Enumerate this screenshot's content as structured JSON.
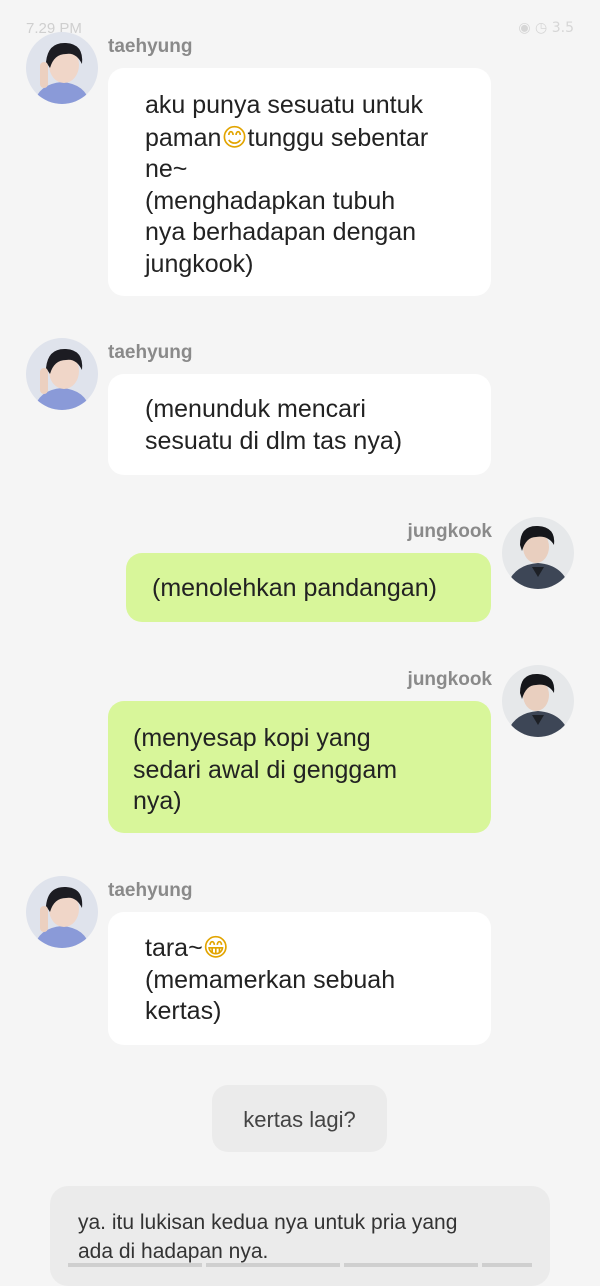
{
  "status_bar": {
    "time": "7.29 PM",
    "icons": "◉ ◷ 3.5"
  },
  "messages": [
    {
      "sender": "taehyung",
      "text_before": "aku punya sesuatu untuk\npaman",
      "emoji": "😊",
      "text_after": "tunggu sebentar\nne~\n(menghadapkan tubuh\nnya berhadapan dengan\njungkook)"
    },
    {
      "sender": "taehyung",
      "text": "(menunduk mencari\nsesuatu di dlm tas nya)"
    },
    {
      "sender": "jungkook",
      "text": "(menolehkan pandangan)"
    },
    {
      "sender": "jungkook",
      "text": "(menyesap kopi yang\nsedari awal di genggam\nnya)"
    },
    {
      "sender": "taehyung",
      "text_before": "tara~",
      "emoji": "😁",
      "text_after": "\n(memamerkan sebuah\nkertas)"
    }
  ],
  "reply": {
    "text": "kertas lagi?"
  },
  "narration": {
    "text": "ya. itu lukisan kedua nya untuk pria yang\nada di hadapan nya."
  },
  "colors": {
    "background": "#f5f5f5",
    "incoming_bubble": "#ffffff",
    "outgoing_bubble": "#d8f69a",
    "name": "#8a8a8a"
  }
}
